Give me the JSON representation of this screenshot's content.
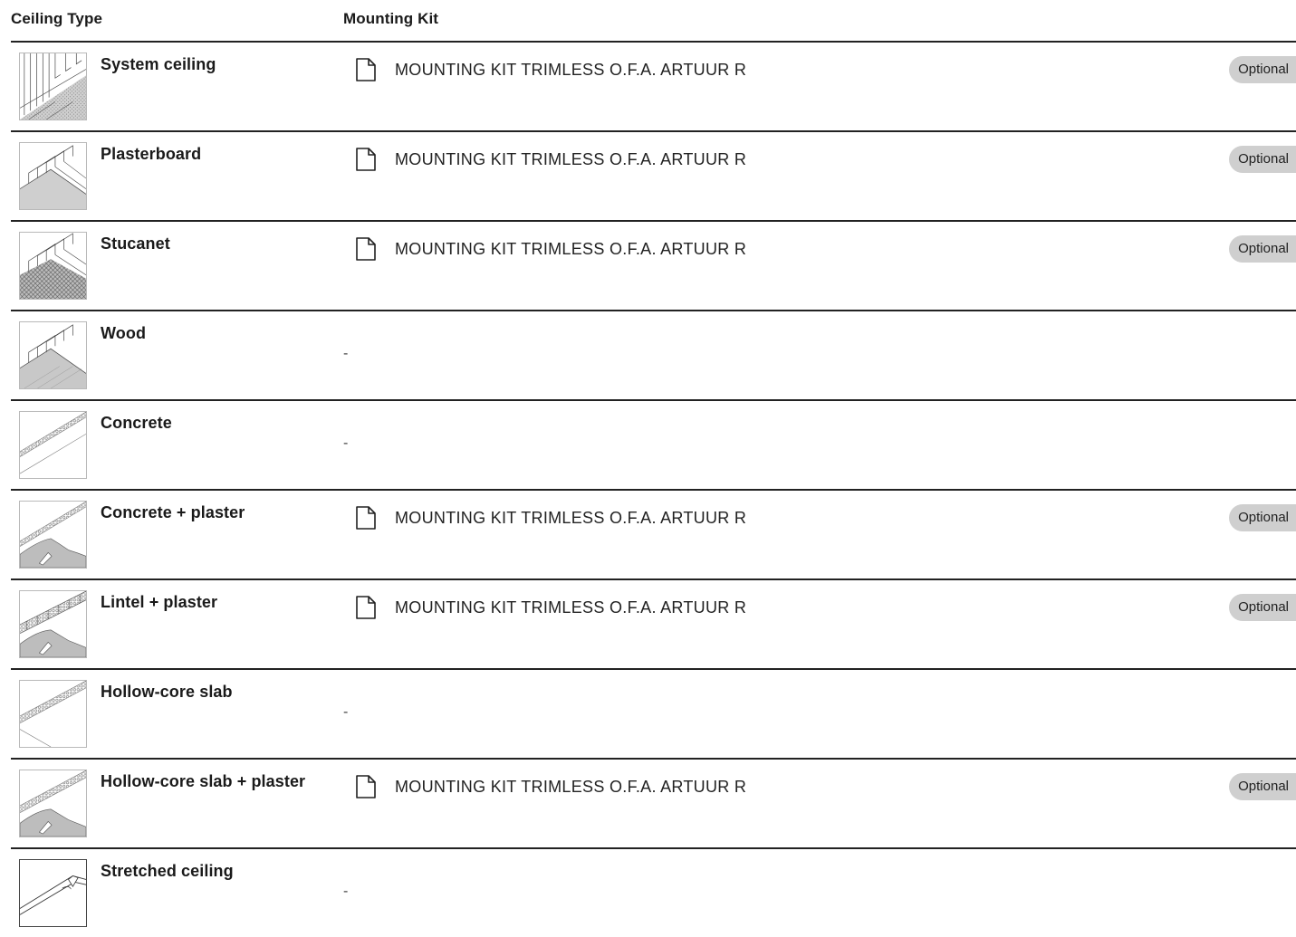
{
  "headers": {
    "ceiling_type": "Ceiling Type",
    "mounting_kit": "Mounting Kit"
  },
  "rows": [
    {
      "ceiling": "System ceiling",
      "thumb_icon": "system-ceiling-illustration",
      "kit": "MOUNTING KIT TRIMLESS O.F.A. ARTUUR R",
      "badge": "Optional"
    },
    {
      "ceiling": "Plasterboard",
      "thumb_icon": "plasterboard-illustration",
      "kit": "MOUNTING KIT TRIMLESS O.F.A. ARTUUR R",
      "badge": "Optional"
    },
    {
      "ceiling": "Stucanet",
      "thumb_icon": "stucanet-illustration",
      "kit": "MOUNTING KIT TRIMLESS O.F.A. ARTUUR R",
      "badge": "Optional"
    },
    {
      "ceiling": "Wood",
      "thumb_icon": "wood-illustration",
      "kit": "-"
    },
    {
      "ceiling": "Concrete",
      "thumb_icon": "concrete-illustration",
      "kit": "-"
    },
    {
      "ceiling": "Concrete + plaster",
      "thumb_icon": "concrete-plaster-illustration",
      "kit": "MOUNTING KIT TRIMLESS O.F.A. ARTUUR R",
      "badge": "Optional"
    },
    {
      "ceiling": "Lintel + plaster",
      "thumb_icon": "lintel-plaster-illustration",
      "kit": "MOUNTING KIT TRIMLESS O.F.A. ARTUUR R",
      "badge": "Optional"
    },
    {
      "ceiling": "Hollow-core slab",
      "thumb_icon": "hollow-core-slab-illustration",
      "kit": "-"
    },
    {
      "ceiling": "Hollow-core slab + plaster",
      "thumb_icon": "hollow-core-slab-plaster-illustration",
      "kit": "MOUNTING KIT TRIMLESS O.F.A. ARTUUR R",
      "badge": "Optional"
    },
    {
      "ceiling": "Stretched ceiling",
      "thumb_icon": "stretched-ceiling-illustration",
      "kit": "-"
    }
  ],
  "icons": {
    "kit_document": "document-icon"
  },
  "colors": {
    "badge_bg": "#cfcfcf",
    "divider": "#222222",
    "text": "#1a1a1a"
  }
}
